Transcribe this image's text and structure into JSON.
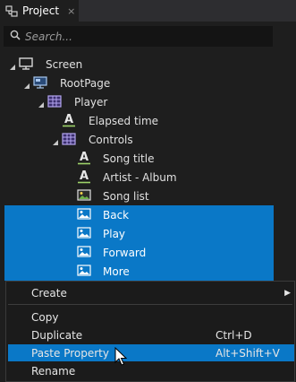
{
  "panel": {
    "title": "Project",
    "close": "×"
  },
  "search": {
    "placeholder": "Search..."
  },
  "tree": [
    {
      "label": "Screen",
      "icon": "monitor-icon",
      "expanded": true,
      "selected": false
    },
    {
      "label": "RootPage",
      "icon": "page-icon",
      "expanded": true,
      "selected": false
    },
    {
      "label": "Player",
      "icon": "grid-layout-icon",
      "expanded": true,
      "selected": false
    },
    {
      "label": "Elapsed time",
      "icon": "text-icon",
      "expanded": false,
      "selected": false
    },
    {
      "label": "Controls",
      "icon": "grid-layout-icon",
      "expanded": true,
      "selected": false
    },
    {
      "label": "Song title",
      "icon": "text-icon",
      "expanded": false,
      "selected": false
    },
    {
      "label": "Artist - Album",
      "icon": "text-icon",
      "expanded": false,
      "selected": false
    },
    {
      "label": "Song list",
      "icon": "image-icon",
      "expanded": false,
      "selected": false
    },
    {
      "label": "Back",
      "icon": "image-icon",
      "expanded": false,
      "selected": true
    },
    {
      "label": "Play",
      "icon": "image-icon",
      "expanded": false,
      "selected": true
    },
    {
      "label": "Forward",
      "icon": "image-icon",
      "expanded": false,
      "selected": true
    },
    {
      "label": "More",
      "icon": "image-icon",
      "expanded": false,
      "selected": true
    }
  ],
  "context_menu": {
    "create": "Create",
    "copy": "Copy",
    "duplicate": "Duplicate",
    "duplicate_shortcut": "Ctrl+D",
    "paste_property": "Paste Property",
    "paste_property_shortcut": "Alt+Shift+V",
    "rename": "Rename",
    "submenu_arrow": "▶"
  },
  "colors": {
    "selection": "#0a78c7",
    "background": "#1e1e1e"
  }
}
